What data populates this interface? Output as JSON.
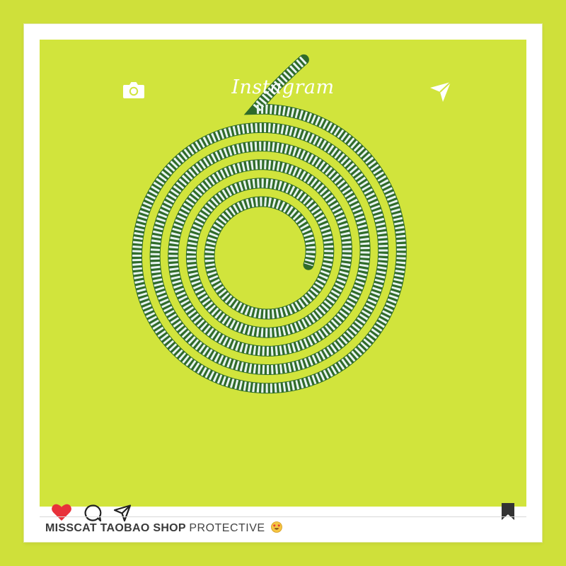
{
  "header": {
    "brand": "Instagram",
    "camera_icon": "camera-icon",
    "send_icon": "paper-plane-icon"
  },
  "photo": {
    "subject": "coiled striped cable protector",
    "background_color": "#d1e43c",
    "coil_colors": [
      "#2f6b2a",
      "#e8f4f0"
    ]
  },
  "actions": {
    "like_icon": "heart-icon",
    "like_color": "#e8313a",
    "comment_icon": "comment-icon",
    "share_icon": "paper-plane-icon",
    "save_icon": "bookmark-icon"
  },
  "caption": {
    "username": "MISSCAT TAOBAO SHOP",
    "text": "PROTECTIVE",
    "emoji_icon": "heart-eyes-emoji-icon"
  }
}
